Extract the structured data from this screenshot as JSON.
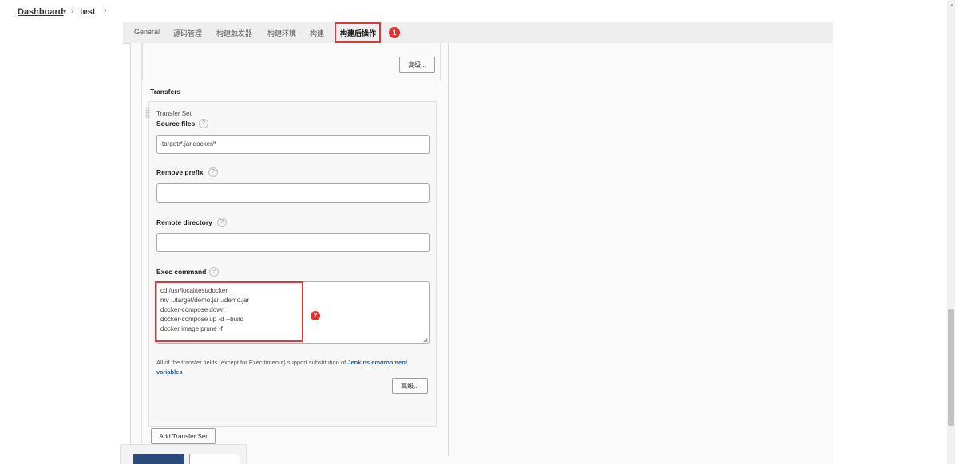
{
  "breadcrumb": {
    "dashboard": "Dashboard",
    "caret": "▾",
    "separator": "›",
    "job": "test"
  },
  "tabs": [
    {
      "label": "General"
    },
    {
      "label": "源码管理"
    },
    {
      "label": "构建触发器"
    },
    {
      "label": "构建环境"
    },
    {
      "label": "构建"
    },
    {
      "label": "构建后操作",
      "active": true
    }
  ],
  "annotations": {
    "badge1": "1",
    "badge2": "2",
    "highlight_color": "#d63a3a"
  },
  "advanced_button_label": "高级...",
  "transfers": {
    "title": "Transfers",
    "set_label": "Transfer Set",
    "source_files": {
      "label": "Source files",
      "value": "target/*.jar,docker/*"
    },
    "remove_prefix": {
      "label": "Remove prefix",
      "value": ""
    },
    "remote_directory": {
      "label": "Remote directory",
      "value": ""
    },
    "exec_command": {
      "label": "Exec command",
      "lines": [
        "cd /usr/local/test/docker",
        "mv ../target/demo.jar ./demo.jar",
        "docker-compose down",
        "docker-compose up -d --build",
        "docker image prune -f"
      ]
    },
    "help_glyph": "?",
    "note_text": "All of the transfer fields (except for Exec timeout) support substitution of ",
    "note_link": "Jenkins environment variables",
    "advanced_label": "高级...",
    "add_button": "Add Transfer Set"
  }
}
